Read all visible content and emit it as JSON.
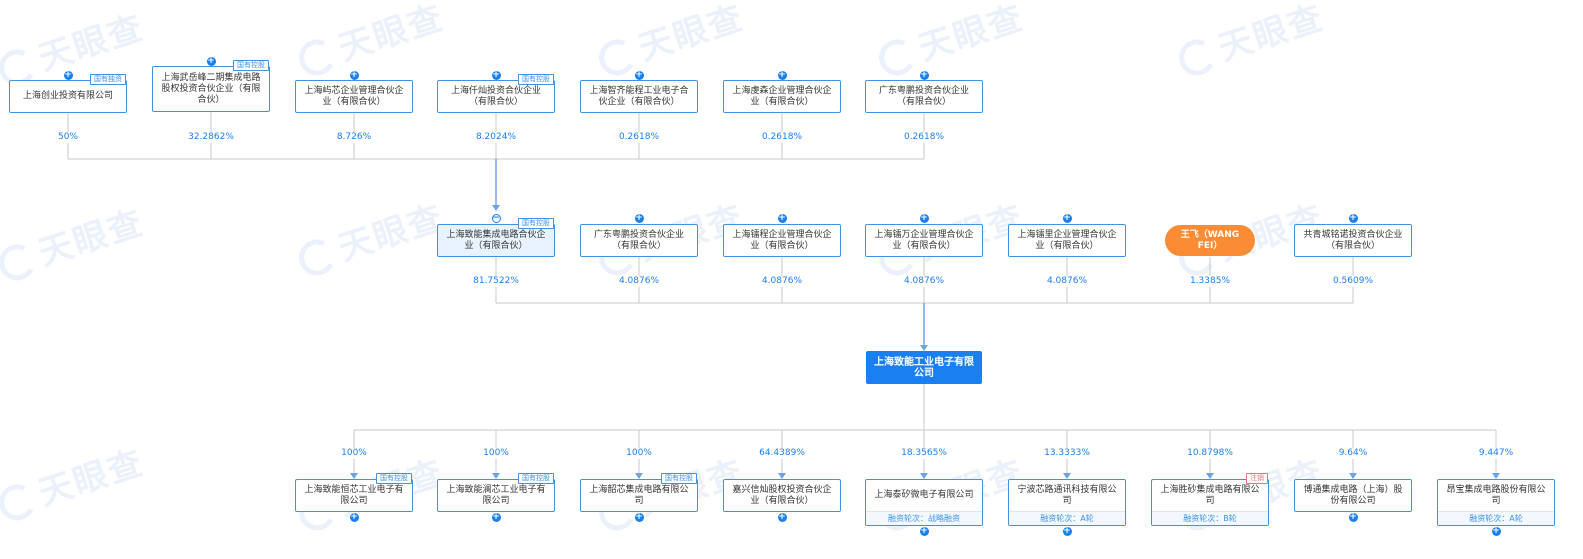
{
  "watermark": {
    "text": "天眼查"
  },
  "colors": {
    "line": "#c9c9c9",
    "main_line": "#6da3e0",
    "accent": "#1a7ff0",
    "person": "#fa8c35"
  },
  "target": {
    "name": "上海致能工业电子有限公司"
  },
  "shareholders_l2": [
    {
      "name": "上海创业投资有限公司",
      "pct": "50%",
      "tag": "国有独资"
    },
    {
      "name": "上海武岳峰二期集成电路股权投资合伙企业（有限合伙）",
      "pct": "32.2862%",
      "tag": "国有控股"
    },
    {
      "name": "上海屿芯企业管理合伙企业（有限合伙）",
      "pct": "8.726%",
      "tag": ""
    },
    {
      "name": "上海仟灿投资合伙企业（有限合伙）",
      "pct": "8.2024%",
      "tag": "国有控股"
    },
    {
      "name": "上海智齐能程工业电子合伙企业（有限合伙）",
      "pct": "0.2618%",
      "tag": ""
    },
    {
      "name": "上海虔森企业管理合伙企业（有限合伙）",
      "pct": "0.2618%",
      "tag": ""
    },
    {
      "name": "广东粤鹏投资合伙企业（有限合伙）",
      "pct": "0.2618%",
      "tag": ""
    }
  ],
  "shareholders_l1": [
    {
      "name": "上海致能集成电路合伙企业（有限合伙）",
      "pct": "81.7522%",
      "tag": "国有控股",
      "expanded": true
    },
    {
      "name": "广东粤鹏投资合伙企业（有限合伙）",
      "pct": "4.0876%",
      "tag": ""
    },
    {
      "name": "上海镭程企业管理合伙企业（有限合伙）",
      "pct": "4.0876%",
      "tag": ""
    },
    {
      "name": "上海镭万企业管理合伙企业（有限合伙）",
      "pct": "4.0876%",
      "tag": ""
    },
    {
      "name": "上海镭里企业管理合伙企业（有限合伙）",
      "pct": "4.0876%",
      "tag": ""
    },
    {
      "name": "王飞（WANG FEI）",
      "pct": "1.3385%",
      "tag": "",
      "person": true
    },
    {
      "name": "共青城铭诺投资合伙企业（有限合伙）",
      "pct": "0.5609%",
      "tag": ""
    }
  ],
  "investments": [
    {
      "name": "上海致能恒芯工业电子有限公司",
      "pct": "100%",
      "tag": "国有控股",
      "sub": ""
    },
    {
      "name": "上海致能澜芯工业电子有限公司",
      "pct": "100%",
      "tag": "国有控股",
      "sub": ""
    },
    {
      "name": "上海韶芯集成电路有限公司",
      "pct": "100%",
      "tag": "国有控股",
      "sub": ""
    },
    {
      "name": "嘉兴信灿股权投资合伙企业（有限合伙）",
      "pct": "64.4389%",
      "tag": "",
      "sub": ""
    },
    {
      "name": "上海泰矽微电子有限公司",
      "pct": "18.3565%",
      "tag": "",
      "sub": "融资轮次：战略融资"
    },
    {
      "name": "宁波芯路通讯科技有限公司",
      "pct": "13.3333%",
      "tag": "",
      "sub": "融资轮次：A轮"
    },
    {
      "name": "上海胜砂集成电路有限公司",
      "pct": "10.8798%",
      "tag": "注销",
      "tag_red": true,
      "sub": "融资轮次：B轮"
    },
    {
      "name": "博通集成电路（上海）股份有限公司",
      "pct": "9.64%",
      "tag": "",
      "sub": ""
    },
    {
      "name": "昂宝集成电路股份有限公司",
      "pct": "9.447%",
      "tag": "",
      "sub": "融资轮次：A轮"
    }
  ]
}
